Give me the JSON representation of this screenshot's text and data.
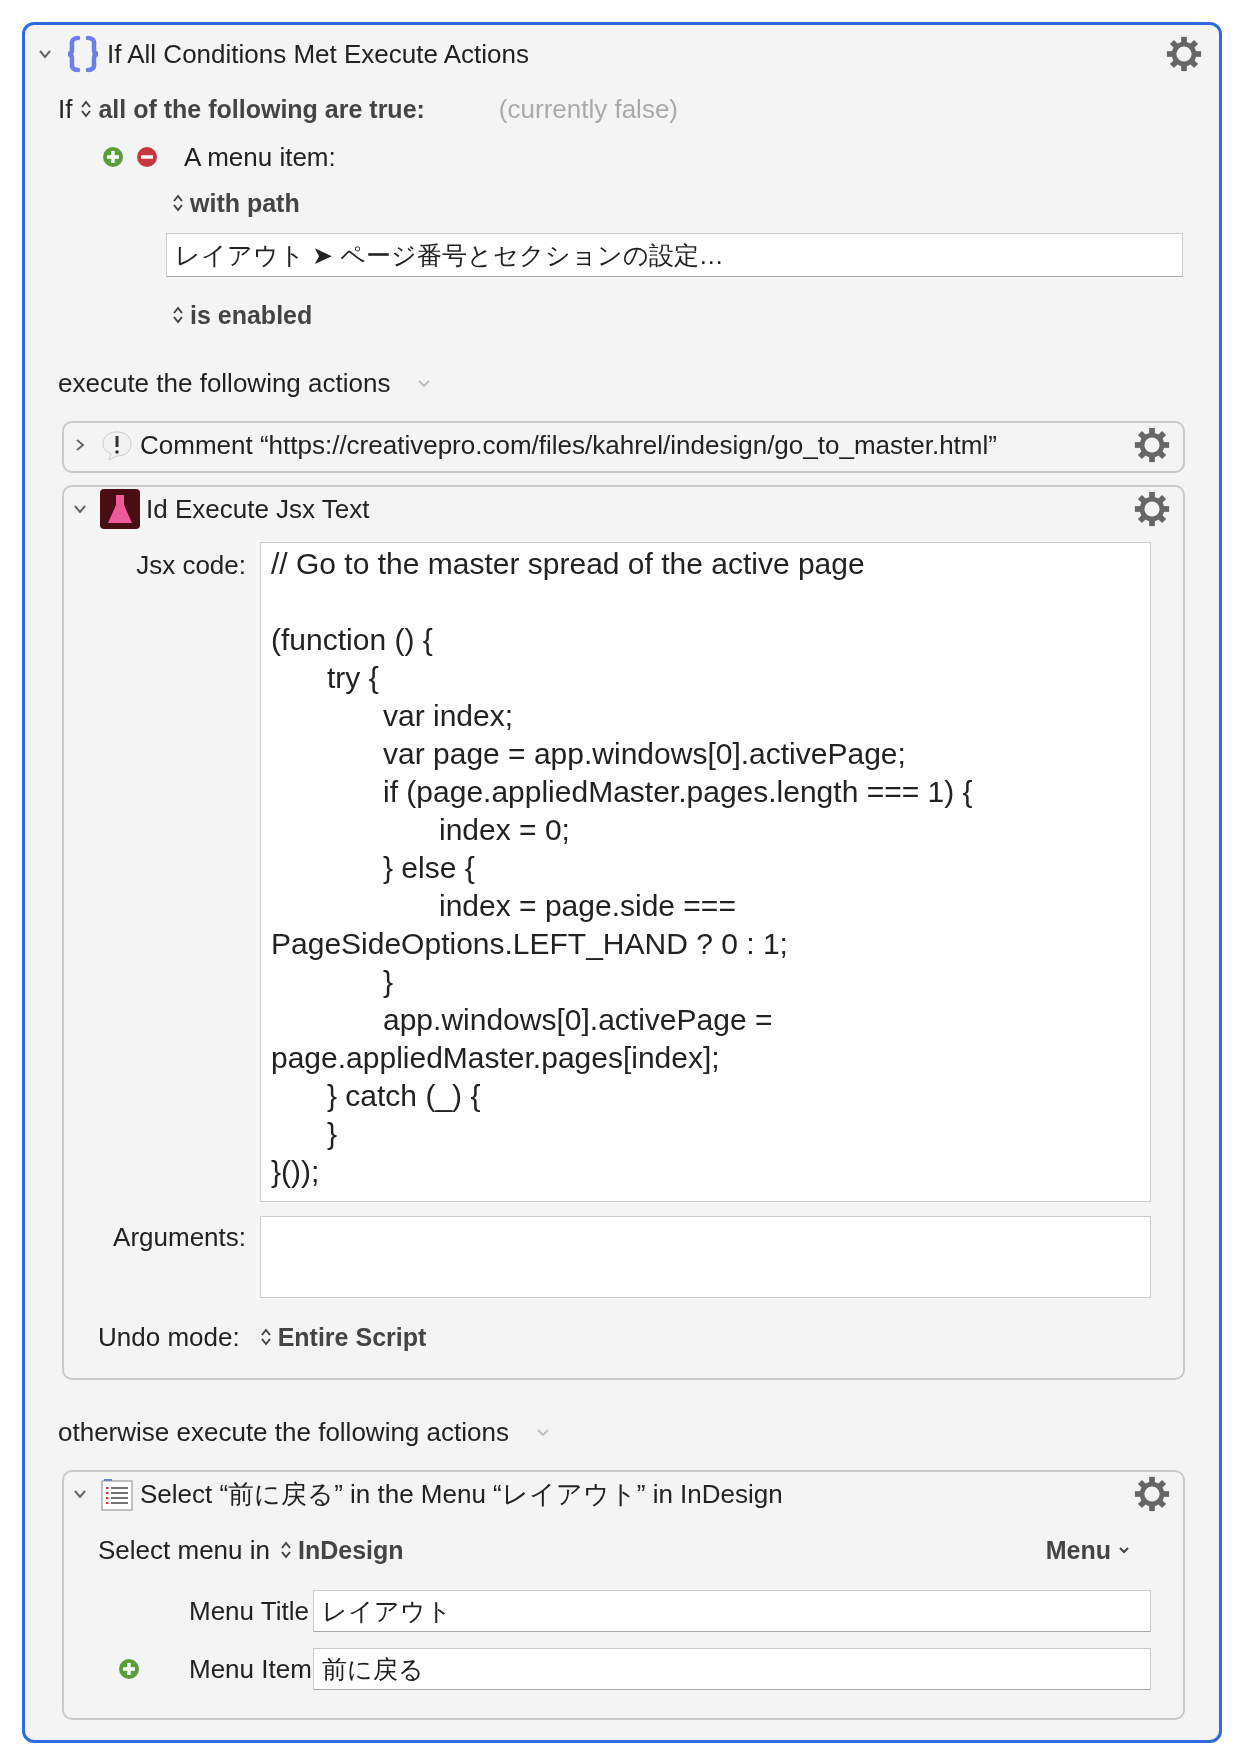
{
  "if_action": {
    "title": "If All Conditions Met Execute Actions",
    "expanded": true,
    "condition_prefix": "If",
    "condition_mode": "all of the following are true:",
    "condition_status": "(currently false)",
    "conditions": [
      {
        "label": "A menu item:",
        "path_mode": "with path",
        "path": "レイアウト ➤ ページ番号とセクションの設定…",
        "state": "is enabled"
      }
    ],
    "branches": [
      {
        "label": "execute the following actions",
        "actions": [
          {
            "kind": "comment",
            "title": "Comment “https://creativepro.com/files/kahrel/indesign/go_to_master.html”",
            "expanded": false
          },
          {
            "kind": "jsx",
            "title": "Id Execute Jsx Text",
            "expanded": true,
            "code_label": "Jsx code:",
            "code": "// Go to the master spread of the active page\n\n(function () {\n\ttry {\n\t\tvar index;\n\t\tvar page = app.windows[0].activePage;\n\t\tif (page.appliedMaster.pages.length === 1) {\n\t\t\tindex = 0;\n\t\t} else {\n\t\t\tindex = page.side ===\nPageSideOptions.LEFT_HAND ? 0 : 1;\n\t\t}\n\t\tapp.windows[0].activePage =\npage.appliedMaster.pages[index];\n\t} catch (_) {\n\t}\n}());",
            "arguments_label": "Arguments:",
            "undo_label": "Undo mode:",
            "undo_mode": "Entire Script"
          }
        ]
      },
      {
        "label": "otherwise execute the following actions",
        "actions": [
          {
            "kind": "menu",
            "title": "Select “前に戻る” in the Menu “レイアウト” in InDesign",
            "expanded": true,
            "select_label": "Select menu in",
            "app": "InDesign",
            "menu_button": "Menu",
            "fields": [
              {
                "label": "Menu Title",
                "value": "レイアウト",
                "addable": false
              },
              {
                "label": "Menu Item",
                "value": "前に戻る",
                "addable": true
              }
            ]
          }
        ]
      }
    ]
  }
}
